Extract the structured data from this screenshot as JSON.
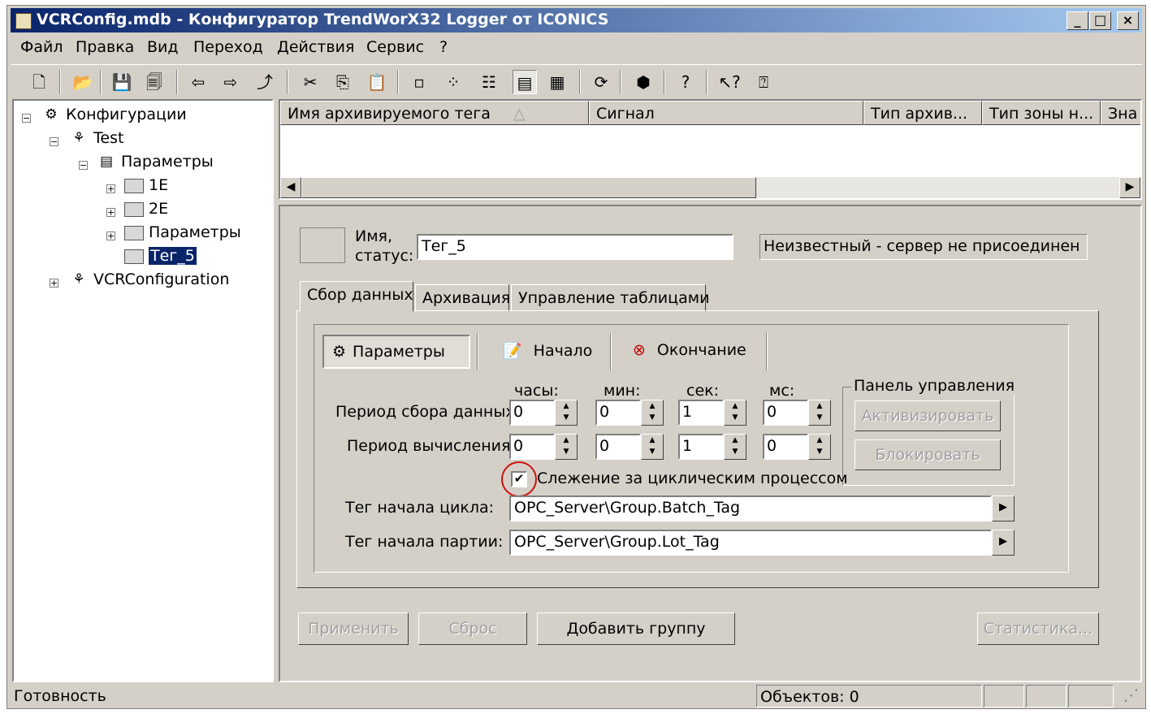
{
  "window": {
    "title": "VCRConfig.mdb - Конфигуратор TrendWorX32 Logger от ICONICS",
    "controls": {
      "minimize": "_",
      "maximize": "□",
      "close": "×"
    }
  },
  "menu": [
    {
      "label": "Файл"
    },
    {
      "label": "Правка"
    },
    {
      "label": "Вид"
    },
    {
      "label": "Переход"
    },
    {
      "label": "Действия"
    },
    {
      "label": "Сервис"
    },
    {
      "label": "?"
    }
  ],
  "toolbar": {
    "icons": [
      "new-file-icon",
      "open-folder-icon",
      "save-icon",
      "save-copy-icon",
      "back-arrow-icon",
      "forward-arrow-icon",
      "up-folder-icon",
      "cut-icon",
      "copy-icon",
      "paste-icon",
      "large-icons-icon",
      "small-icons-icon",
      "list-icon",
      "details-icon",
      "properties-icon",
      "refresh-icon",
      "stop-icon",
      "help-icon",
      "context-help-icon",
      "about-icon"
    ]
  },
  "tree": {
    "nodes": [
      {
        "label": "Конфигурации"
      },
      {
        "label": "Test"
      },
      {
        "label": "Параметры"
      },
      {
        "label": "1E"
      },
      {
        "label": "2E"
      },
      {
        "label": "Параметры"
      },
      {
        "label": "Тег_5"
      },
      {
        "label": "VCRConfiguration"
      }
    ]
  },
  "list": {
    "columns": [
      "Имя архивируемого тега",
      "Сигнал",
      "Тип архив...",
      "Тип зоны н...",
      "Зна"
    ]
  },
  "detail": {
    "name_label_1": "Имя,",
    "name_label_2": "статус:",
    "name_value": "Тег_5",
    "status_value": "Неизвестный - сервер не присоединен",
    "tabs": [
      "Сбор данных",
      "Архивация",
      "Управление таблицами"
    ],
    "subtabs": [
      "Параметры",
      "Начало",
      "Окончание"
    ],
    "units": [
      "часы:",
      "мин:",
      "сек:",
      "мс:"
    ],
    "collect_label": "Период сбора данных:",
    "calc_label": "Период вычисления:",
    "collect_values": [
      "0",
      "0",
      "1",
      "0"
    ],
    "calc_values": [
      "0",
      "0",
      "1",
      "0"
    ],
    "control_panel": {
      "title": "Панель управления",
      "activate": "Активизировать",
      "block": "Блокировать"
    },
    "tracking_label": "Слежение за циклическим процессом",
    "tracking_checked": "✔",
    "cycle_start_label": "Тег начала цикла:",
    "cycle_start_value": "OPC_Server\\Group.Batch_Tag",
    "lot_start_label": "Тег начала партии:",
    "lot_start_value": "OPC_Server\\Group.Lot_Tag",
    "buttons": {
      "apply": "Применить",
      "reset": "Сброс",
      "add_group": "Добавить группу",
      "stats": "Статистика..."
    }
  },
  "statusbar": {
    "left": "Готовность",
    "objects": "Объектов: 0"
  }
}
